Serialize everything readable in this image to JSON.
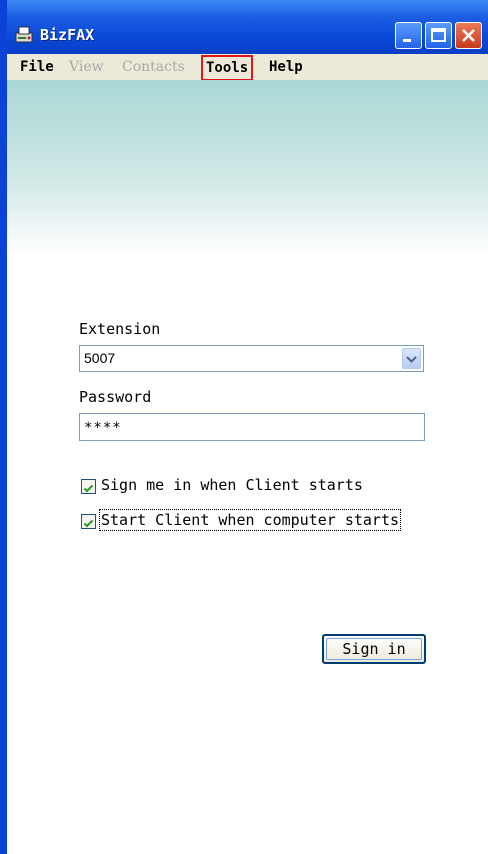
{
  "window": {
    "title": "BizFAX"
  },
  "menu": {
    "file": "File",
    "view": "View",
    "contacts": "Contacts",
    "tools": "Tools",
    "help": "Help"
  },
  "form": {
    "extension_label": "Extension",
    "extension_value": "5007",
    "password_label": "Password",
    "password_value": "****",
    "auto_signin_label": "Sign me in when Client starts",
    "auto_signin_checked": true,
    "auto_start_label": "Start Client when computer starts",
    "auto_start_checked": true,
    "signin_button": "Sign in"
  },
  "icons": {
    "app": "fax-app-icon",
    "minimize": "minimize-icon",
    "maximize": "maximize-icon",
    "close": "close-icon",
    "dropdown": "chevron-down-icon",
    "check": "checkmark-icon"
  },
  "colors": {
    "titlebar": "#0a48d8",
    "menubar": "#ece9d8",
    "highlight_box": "#e01818",
    "banner_top": "#a9d7d4",
    "check": "#1e9e1e"
  }
}
